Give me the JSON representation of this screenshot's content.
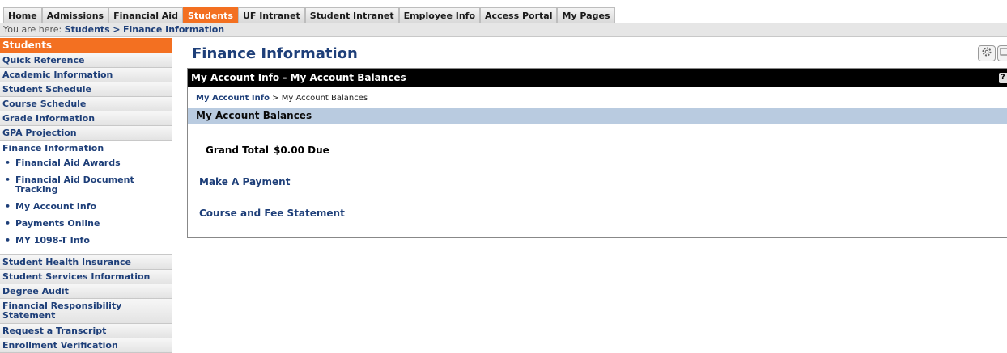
{
  "topnav": {
    "tabs": [
      {
        "label": "Home",
        "active": false
      },
      {
        "label": "Admissions",
        "active": false
      },
      {
        "label": "Financial Aid",
        "active": false
      },
      {
        "label": "Students",
        "active": true
      },
      {
        "label": "UF Intranet",
        "active": false
      },
      {
        "label": "Student Intranet",
        "active": false
      },
      {
        "label": "Employee Info",
        "active": false
      },
      {
        "label": "Access Portal",
        "active": false
      },
      {
        "label": "My Pages",
        "active": false
      }
    ]
  },
  "breadcrumb": {
    "prefix": "You are here:",
    "items": [
      "Students",
      "Finance Information"
    ],
    "separator": ">"
  },
  "sidebar": {
    "header": "Students",
    "items_top": [
      "Quick Reference",
      "Academic Information",
      "Student Schedule",
      "Course Schedule",
      "Grade Information",
      "GPA Projection"
    ],
    "current_section": "Finance Information",
    "sub_items": [
      "Financial Aid Awards",
      "Financial Aid Document Tracking",
      "My Account Info",
      "Payments Online",
      "MY 1098-T Info"
    ],
    "items_bottom": [
      "Student Health Insurance",
      "Student Services Information",
      "Degree Audit",
      "Financial Responsibility Statement",
      "Request a Transcript",
      "Enrollment Verification"
    ],
    "bullet": "•"
  },
  "main": {
    "title": "Finance Information",
    "tools": {
      "settings_icon": "gear-icon",
      "second_icon": "window-icon"
    },
    "portlet": {
      "header": "My Account Info - My Account Balances",
      "help_label": "?",
      "crumb_link": "My Account Info",
      "crumb_sep": ">",
      "crumb_current": "My Account Balances",
      "section_title": "My Account Balances",
      "grand_total_label": "Grand Total",
      "grand_total_value": "$0.00 Due",
      "links": [
        "Make A Payment",
        "Course and Fee Statement"
      ]
    }
  },
  "colors": {
    "accent_orange": "#f37021",
    "link_blue": "#1e3f79",
    "section_bar": "#b9cbe0",
    "portlet_header": "#000000"
  }
}
